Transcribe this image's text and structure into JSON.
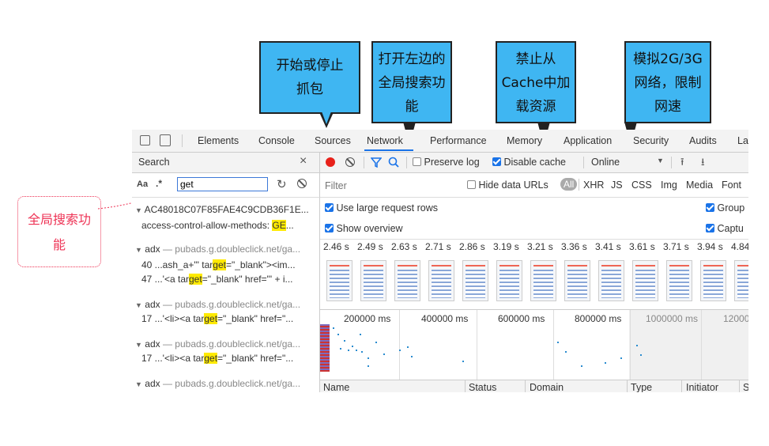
{
  "callouts": {
    "record": "开始或停止抓包",
    "search": "打开左边的全局搜索功能",
    "cache": "禁止从Cache中加载资源",
    "throttle": "模拟2G/3G网络，限制网速",
    "global_search": "全局搜索功能"
  },
  "tabs": [
    "Elements",
    "Console",
    "Sources",
    "Network",
    "Performance",
    "Memory",
    "Application",
    "Security",
    "Audits",
    "La"
  ],
  "search_panel": {
    "title": "Search",
    "close": "×",
    "aa_label": "Aa",
    "regex_label": ".*",
    "query": "get",
    "results": [
      {
        "header": "AC48018C07F85FAE4C9CDB36F1E...",
        "lines": [
          [
            "access-control-allow-methods:  ",
            "GE",
            "..."
          ]
        ]
      },
      {
        "header_name": "adx",
        "header_url": "— pubads.g.doubleclick.net/ga...",
        "lines": [
          [
            "40  ...ash_a+'\" tar",
            "get",
            "=\"_blank\"><im..."
          ],
          [
            "47  ...'<a tar",
            "get",
            "=\"_blank\" href=\"' + i..."
          ]
        ]
      },
      {
        "header_name": "adx",
        "header_url": "— pubads.g.doubleclick.net/ga...",
        "lines": [
          [
            "17  ...'<li><a tar",
            "get",
            "=\"_blank\" href=\"..."
          ]
        ]
      },
      {
        "header_name": "adx",
        "header_url": "— pubads.g.doubleclick.net/ga...",
        "lines": [
          [
            "17  ...'<li><a tar",
            "get",
            "=\"_blank\" href=\"..."
          ]
        ]
      },
      {
        "header_name": "adx",
        "header_url": "— pubads.g.doubleclick.net/ga...",
        "lines": []
      }
    ]
  },
  "toolbar": {
    "preserve_log": "Preserve log",
    "disable_cache": "Disable cache",
    "throttle": "Online"
  },
  "filter": {
    "placeholder": "Filter",
    "hide_data_urls": "Hide data URLs",
    "types": [
      "All",
      "XHR",
      "JS",
      "CSS",
      "Img",
      "Media",
      "Font"
    ]
  },
  "options": {
    "large_rows": "Use large request rows",
    "overview": "Show overview",
    "group": "Group",
    "capture": "Captu"
  },
  "frame_times": [
    "2.46 s",
    "2.49 s",
    "2.63 s",
    "2.71 s",
    "2.86 s",
    "3.19 s",
    "3.21 s",
    "3.36 s",
    "3.41 s",
    "3.61 s",
    "3.71 s",
    "3.94 s",
    "4.84"
  ],
  "timeline_ticks": [
    "200000 ms",
    "400000 ms",
    "600000 ms",
    "800000 ms",
    "1000000 ms",
    "12000"
  ],
  "table_columns": [
    "Name",
    "Status",
    "Domain",
    "Type",
    "Initiator",
    "S"
  ]
}
